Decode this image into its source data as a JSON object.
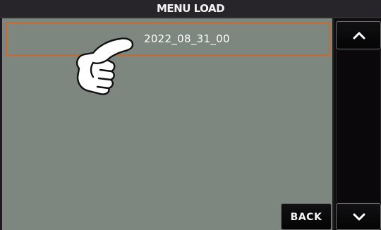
{
  "header": {
    "title": "MENU LOAD"
  },
  "list": {
    "items": [
      {
        "label": "2022_08_31_00",
        "selected": true
      }
    ]
  },
  "buttons": {
    "back_label": "BACK",
    "scroll_up_icon": "chevron-up-icon",
    "scroll_down_icon": "chevron-down-icon"
  },
  "colors": {
    "selection_border": "#c86a2d",
    "list_background": "#7d877f",
    "chrome_background": "#1e1b1f"
  },
  "cursor": {
    "icon": "pointing-hand-icon"
  }
}
